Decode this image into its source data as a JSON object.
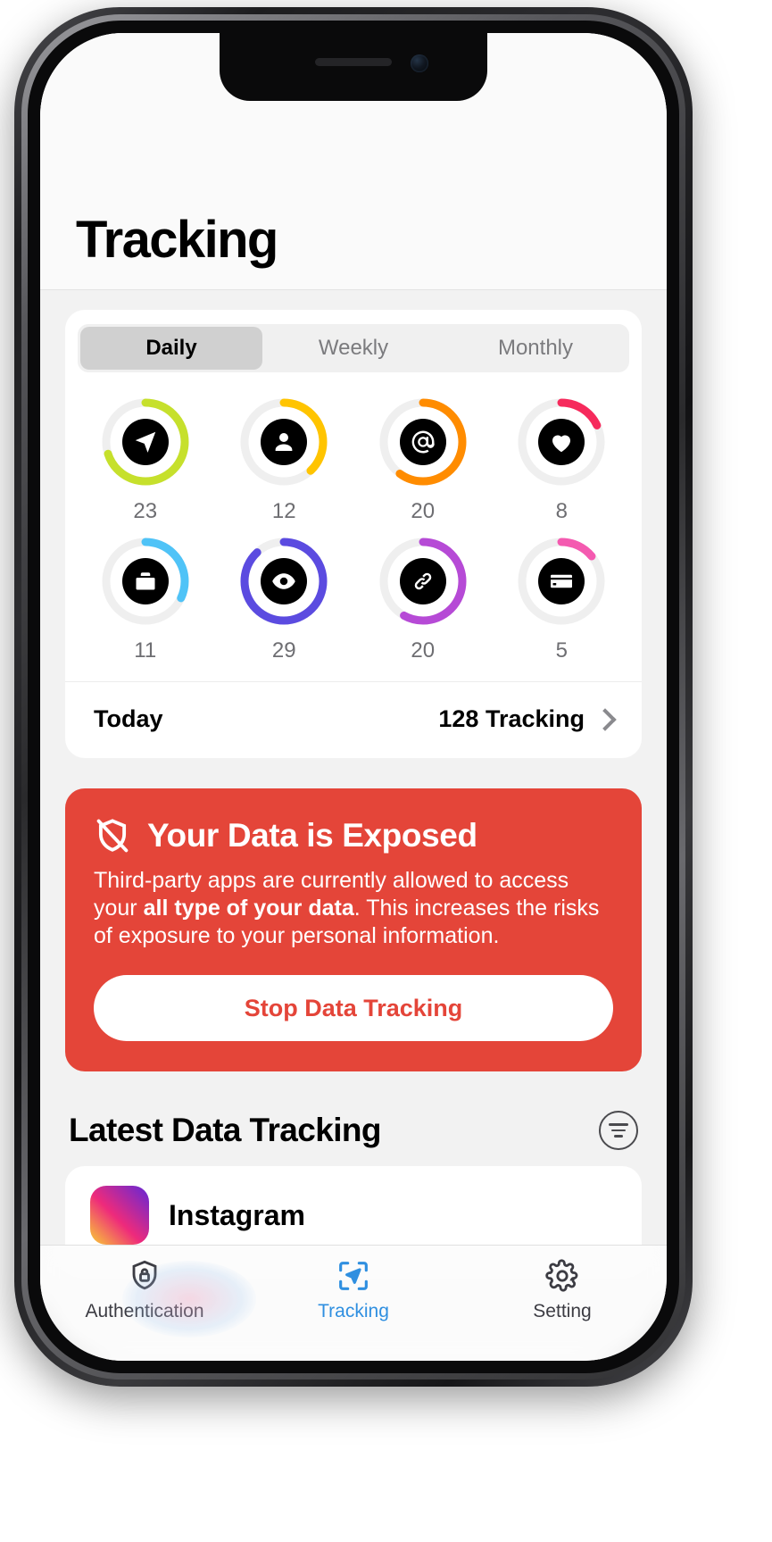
{
  "header": {
    "title": "Tracking"
  },
  "segmented": {
    "options": [
      {
        "label": "Daily",
        "selected": true
      },
      {
        "label": "Weekly",
        "selected": false
      },
      {
        "label": "Monthly",
        "selected": false
      }
    ]
  },
  "rings": [
    {
      "icon": "location-arrow-icon",
      "value": "23",
      "color": "#c6e02c",
      "percent": 70
    },
    {
      "icon": "person-icon",
      "value": "12",
      "color": "#ffc400",
      "percent": 38
    },
    {
      "icon": "at-sign-icon",
      "value": "20",
      "color": "#ff8c00",
      "percent": 60
    },
    {
      "icon": "heart-icon",
      "value": "8",
      "color": "#f62a5c",
      "percent": 18
    },
    {
      "icon": "briefcase-icon",
      "value": "11",
      "color": "#4fc3f7",
      "percent": 32
    },
    {
      "icon": "eye-icon",
      "value": "29",
      "color": "#5b4be0",
      "percent": 88
    },
    {
      "icon": "link-icon",
      "value": "20",
      "color": "#b64ad6",
      "percent": 58
    },
    {
      "icon": "credit-card-icon",
      "value": "5",
      "color": "#f45ab0",
      "percent": 14
    }
  ],
  "summary": {
    "label": "Today",
    "count": "128 Tracking",
    "chevron": "chevron-right-icon"
  },
  "alert": {
    "icon": "shield-slash-icon",
    "title": "Your Data is Exposed",
    "body_part1": "Third-party apps are currently allowed to access your ",
    "body_bold": "all type of your data",
    "body_part2": ". This increases the risks of exposure to your personal information.",
    "button_label": "Stop Data Tracking",
    "bg_color": "#e44539"
  },
  "latest": {
    "title": "Latest Data Tracking",
    "filter_icon": "filter-lines-icon",
    "items": [
      {
        "name": "Instagram"
      }
    ]
  },
  "tabbar": {
    "items": [
      {
        "label": "Authentication",
        "icon": "shield-lock-icon",
        "active": false
      },
      {
        "label": "Tracking",
        "icon": "location-scan-icon",
        "active": true
      },
      {
        "label": "Setting",
        "icon": "gear-icon",
        "active": false
      }
    ],
    "active_color": "#2f8fe0"
  }
}
